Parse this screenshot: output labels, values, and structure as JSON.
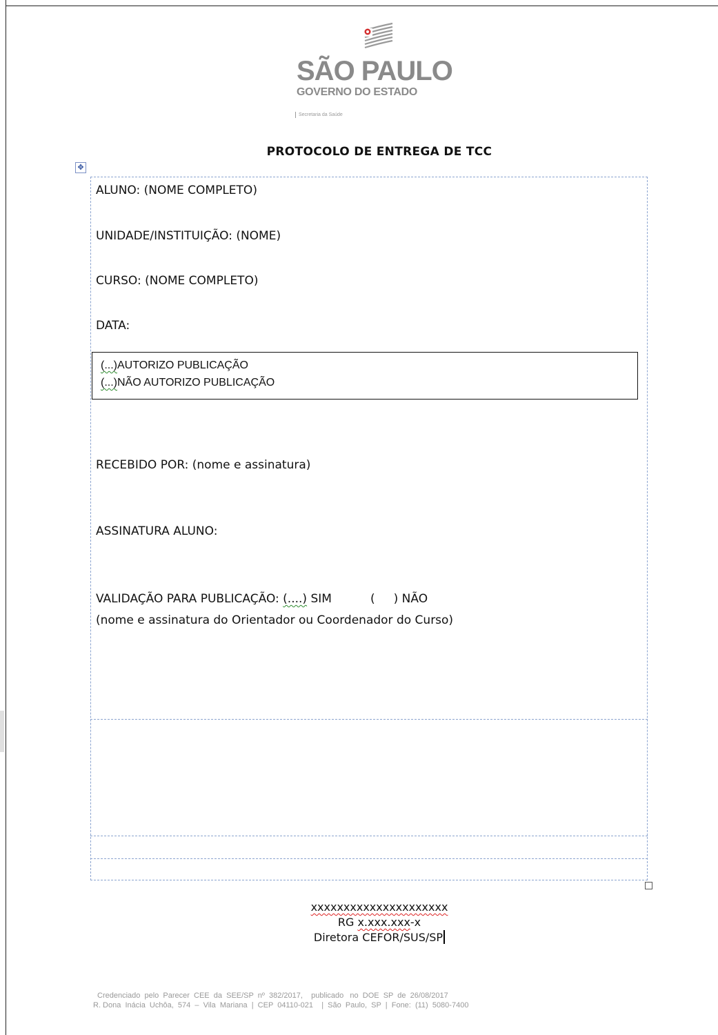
{
  "logo": {
    "state": "SÃO PAULO",
    "government": "GOVERNO DO ESTADO",
    "department": "Secretaria da Saúde"
  },
  "title": "PROTOCOLO DE ENTREGA DE TCC",
  "fields": {
    "aluno": "ALUNO: (NOME COMPLETO)",
    "unidade": "UNIDADE/INSTITUIÇÃO: (NOME)",
    "curso": "CURSO: (NOME COMPLETO)",
    "data": "DATA:",
    "recebido": "RECEBIDO POR: (nome e assinatura)",
    "assinatura": "ASSINATURA ALUNO:",
    "validacao_label": "VALIDAÇÃO PARA PUBLICAÇÃO: ",
    "validacao_blank": "(....)",
    "validacao_sim": " SIM",
    "validacao_nao": "(     ) NÃO",
    "validacao_note": "(nome e assinatura do Orientador ou Coordenador do Curso)"
  },
  "consent": {
    "checkbox": "(...)",
    "option_authorize": "AUTORIZO PUBLICAÇÃO",
    "option_not_authorize": "NÃO AUTORIZO PUBLICAÇÃO"
  },
  "signature": {
    "name": "xxxxxxxxxxxxxxxxxxxxx",
    "rg_prefix": "RG ",
    "rg_number": "x.xxx.xxx",
    "rg_suffix": "-x",
    "role": "Diretora CEFOR/SUS/SP"
  },
  "footer": {
    "line1": "Credenciado  pelo  Parecer  CEE  da  SEE/SP  nº  382/2017,    publicado   no  DOE  SP  de  26/08/2017",
    "line2": "R. Dona  Inácia  Uchôa,  574  –  Vila  Mariana  |  CEP  04110-021    |  São  Paulo,  SP  |  Fone:  (11)  5080-7400"
  },
  "icons": {
    "table_move": "move-arrows-icon",
    "table_resize": "resize-handle-icon"
  }
}
